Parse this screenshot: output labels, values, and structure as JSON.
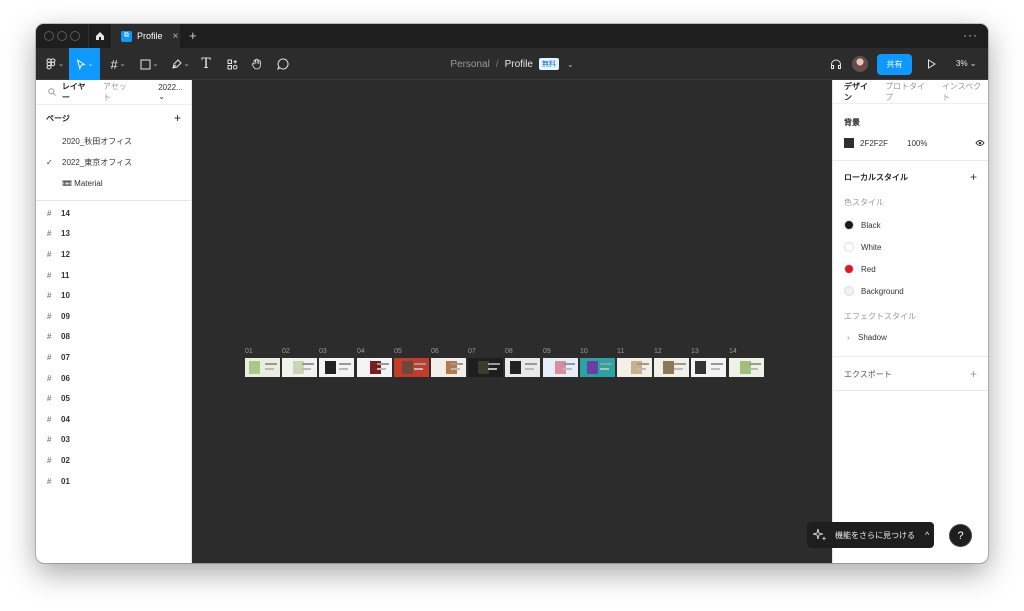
{
  "tabs": {
    "home_icon": "home-icon",
    "file_tab_label": "Profile",
    "close_glyph": "×",
    "new_tab_glyph": "+",
    "more_glyph": "···"
  },
  "breadcrumb": {
    "team": "Personal",
    "separator": "/",
    "file": "Profile",
    "badge": "無料",
    "chevron": "⌄"
  },
  "toolbar": {
    "share_label": "共有",
    "zoom_label": "3% ⌄",
    "caret": "⌄"
  },
  "left_panel": {
    "tab_layers": "レイヤー",
    "tab_assets": "アセット",
    "page_selector": "2022... ⌄",
    "pages_title": "ページ",
    "add_glyph": "+",
    "pages": [
      {
        "name": "2020_秋田オフィス",
        "checked": ""
      },
      {
        "name": "2022_東京オフィス",
        "checked": "✓"
      },
      {
        "name": "📼 Material",
        "checked": ""
      }
    ],
    "layers": [
      "14",
      "13",
      "12",
      "11",
      "10",
      "09",
      "08",
      "07",
      "06",
      "05",
      "04",
      "03",
      "02",
      "01"
    ]
  },
  "canvas": {
    "frame_labels": [
      "01",
      "02",
      "03",
      "04",
      "05",
      "06",
      "07",
      "08",
      "09",
      "10",
      "11",
      "12",
      "13",
      "14"
    ]
  },
  "right_panel": {
    "tab_design": "デザイン",
    "tab_prototype": "プロトタイプ",
    "tab_inspect": "インスペクト",
    "background_title": "背景",
    "background_hex": "2F2F2F",
    "background_opacity": "100%",
    "background_color": "#2f2f2f",
    "local_styles_title": "ローカルスタイル",
    "add_glyph": "+",
    "color_styles_title": "色スタイル",
    "color_styles": [
      {
        "name": "Black",
        "color": "#1a1a1a"
      },
      {
        "name": "White",
        "color": "#ffffff"
      },
      {
        "name": "Red",
        "color": "#e0162b"
      },
      {
        "name": "Background",
        "color": "#f2f2f2"
      }
    ],
    "effect_styles_title": "エフェクトスタイル",
    "effect_styles": [
      "Shadow"
    ],
    "export_title": "エクスポート"
  },
  "widgets": {
    "discover_label": "機能をさらに見つける",
    "help_glyph": "?"
  }
}
